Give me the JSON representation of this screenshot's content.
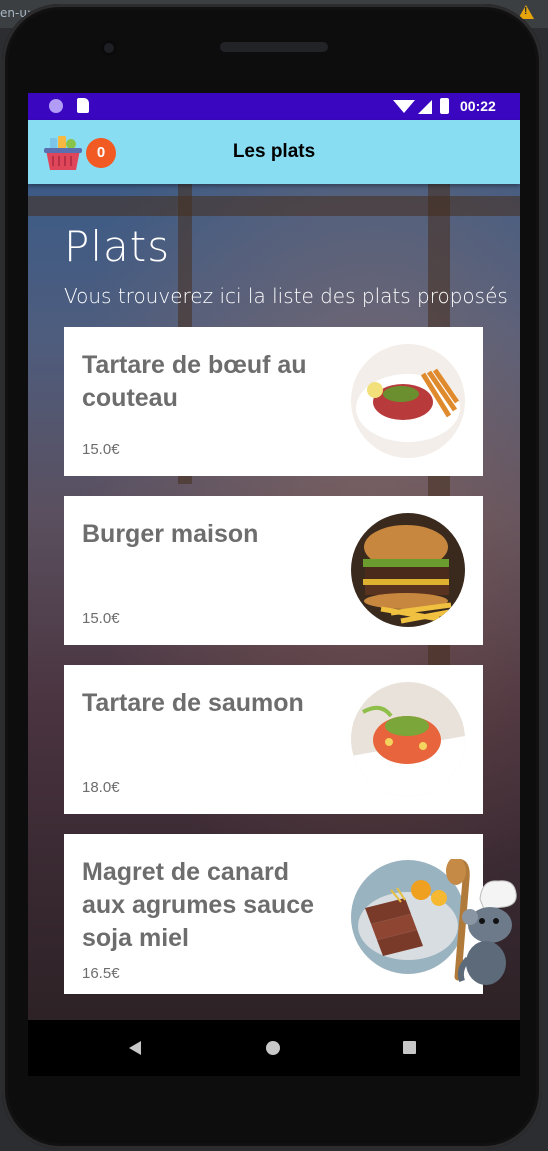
{
  "host": {
    "partial_text": "en-u:"
  },
  "statusbar": {
    "time": "00:22"
  },
  "appbar": {
    "title": "Les plats",
    "cart_count": "0"
  },
  "page": {
    "title": "Plats",
    "subtitle": "Vous trouverez ici la liste des plats proposés"
  },
  "dishes": [
    {
      "name": "Tartare de bœuf au couteau",
      "price": "15.0€"
    },
    {
      "name": "Burger maison",
      "price": "15.0€"
    },
    {
      "name": "Tartare de saumon",
      "price": "18.0€"
    },
    {
      "name": "Magret de canard aux agrumes sauce soja miel",
      "price": "16.5€"
    }
  ],
  "colors": {
    "statusbar": "#3a06c0",
    "appbar": "#88ddf3",
    "badge": "#f15a22",
    "dish_text": "#6d6d6d"
  },
  "icons": [
    "basket-icon",
    "sd-card-icon",
    "wifi-icon",
    "signal-icon",
    "battery-icon",
    "chef-rat-icon",
    "back-icon",
    "home-icon",
    "recents-icon"
  ]
}
